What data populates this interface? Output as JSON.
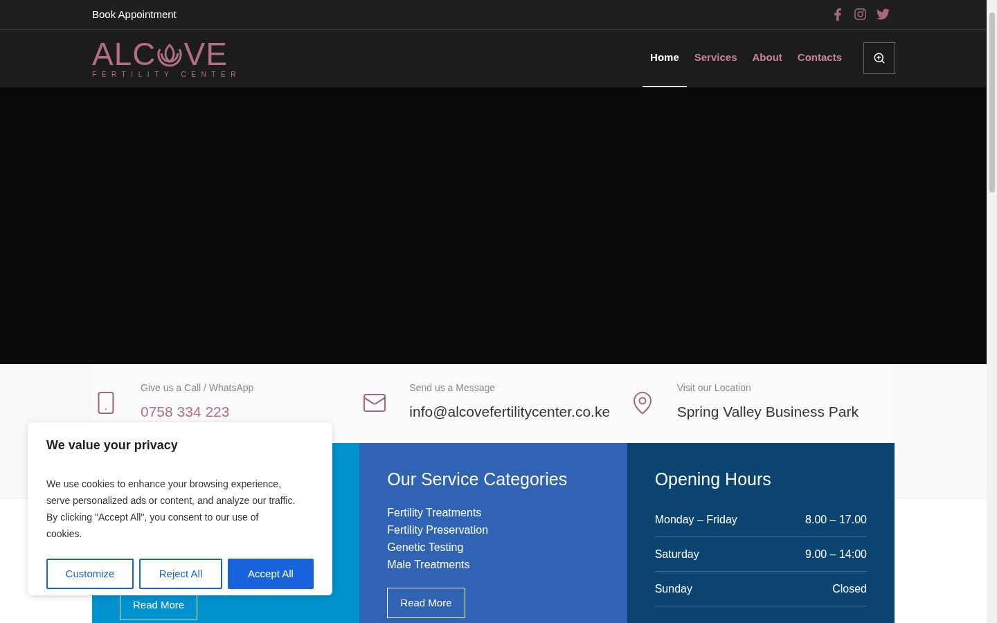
{
  "top_bar": {
    "link": "Book Appointment",
    "social": [
      {
        "kind": "facebook"
      },
      {
        "kind": "instagram"
      },
      {
        "kind": "twitter"
      }
    ]
  },
  "logo": {
    "left": "ALC",
    "right": "VE",
    "tagline": "FERTILITY CENTER"
  },
  "nav": [
    {
      "label": "Home",
      "selected": true
    },
    {
      "label": "Services",
      "selected": false
    },
    {
      "label": "About",
      "selected": false
    },
    {
      "label": "Contacts",
      "selected": false
    }
  ],
  "contacts": [
    {
      "kind": "phone",
      "label": "Give us a Call / WhatsApp",
      "value": "0758 334 223",
      "accent": true
    },
    {
      "kind": "mail",
      "label": "Send us a Message",
      "value": "info@alcovefertilitycenter.co.ke",
      "accent": false
    },
    {
      "kind": "location",
      "label": "Visit our Location",
      "value": "Spring Valley Business Park",
      "accent": false
    }
  ],
  "panels": [
    {
      "kind": "plain",
      "color": "#0092cf",
      "button": "Read More"
    },
    {
      "kind": "list",
      "color": "#3063b3",
      "title": "Our Service Categories",
      "items": [
        "Fertility Treatments",
        "Fertility Preservation",
        "Genetic Testing",
        "Male Treatments"
      ],
      "button": "Read More"
    },
    {
      "kind": "hours",
      "color": "#0b4470",
      "title": "Opening Hours",
      "rows": [
        {
          "day": "Monday – Friday",
          "time": "8.00 – 17.00"
        },
        {
          "day": "Saturday",
          "time": "9.00 – 14:00"
        },
        {
          "day": "Sunday",
          "time": "Closed"
        }
      ]
    }
  ],
  "cookie_dialog": {
    "title": "We value your privacy",
    "text": "We use cookies to enhance your browsing experience, serve personalized ads or content, and analyze our traffic. By clicking \"Accept All\", you consent to our use of cookies.",
    "buttons": [
      {
        "label": "Customize",
        "primary": false
      },
      {
        "label": "Reject All",
        "primary": false
      },
      {
        "label": "Accept All",
        "primary": true
      }
    ]
  }
}
